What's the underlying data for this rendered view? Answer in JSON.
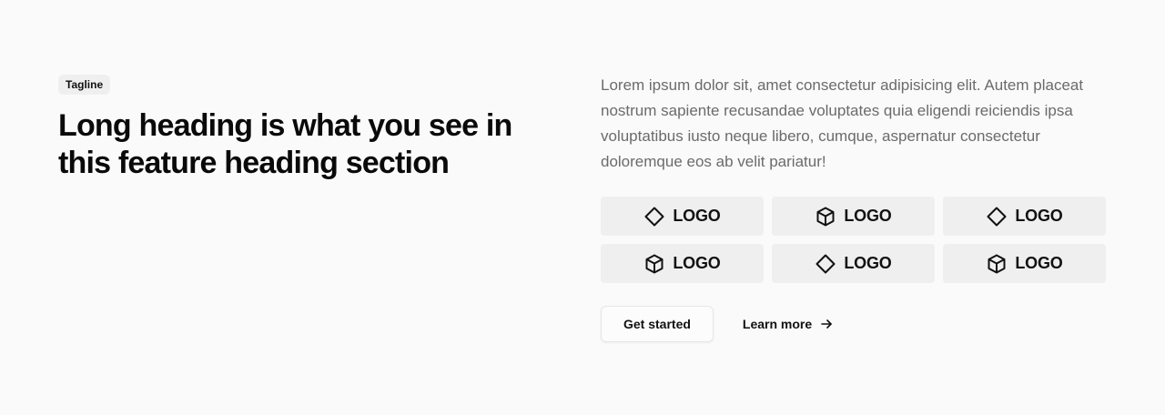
{
  "header": {
    "tagline": "Tagline",
    "heading": "Long heading is what you see in this feature heading section"
  },
  "content": {
    "body": "Lorem ipsum dolor sit, amet consectetur adipisicing elit. Autem placeat nostrum sapiente recusandae voluptates quia eligendi reiciendis ipsa voluptatibus iusto neque libero, cumque, aspernatur consectetur doloremque eos ab velit pariatur!"
  },
  "logos": [
    {
      "icon": "diamond-icon",
      "label": "LOGO"
    },
    {
      "icon": "cube-icon",
      "label": "LOGO"
    },
    {
      "icon": "diamond-icon",
      "label": "LOGO"
    },
    {
      "icon": "cube-icon",
      "label": "LOGO"
    },
    {
      "icon": "diamond-icon",
      "label": "LOGO"
    },
    {
      "icon": "cube-icon",
      "label": "LOGO"
    }
  ],
  "actions": {
    "primary_label": "Get started",
    "secondary_label": "Learn more",
    "secondary_icon": "arrow-right-icon"
  }
}
